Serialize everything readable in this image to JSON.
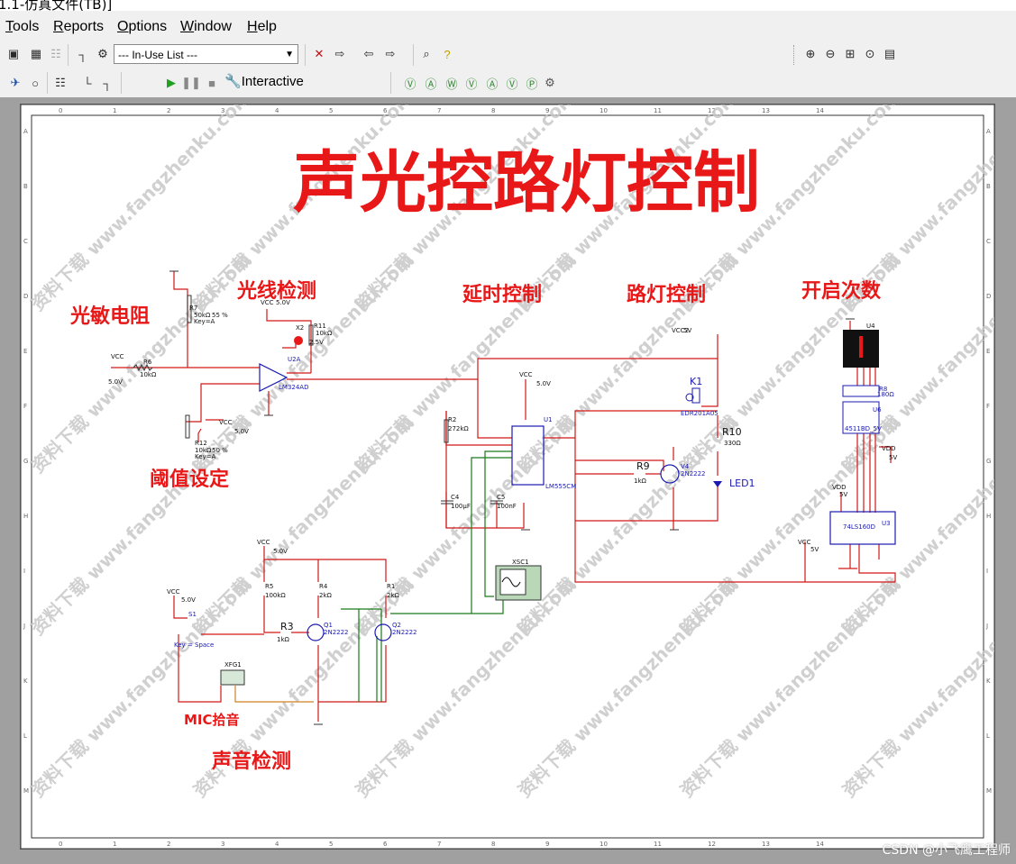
{
  "window": {
    "title": "1.1-仿真文件(TB)]"
  },
  "menu": [
    "Tools",
    "Reports",
    "Options",
    "Window",
    "Help"
  ],
  "menu_hotkeys": [
    "T",
    "R",
    "O",
    "W",
    "H"
  ],
  "toolbar": {
    "in_use_list": "--- In-Use List ---",
    "interactive_label": "Interactive"
  },
  "schematic": {
    "title": "声光控路灯控制",
    "sections": {
      "photo": "光敏电阻",
      "light_detect": "光线检测",
      "delay": "延时控制",
      "lamp": "路灯控制",
      "count": "开启次数",
      "threshold": "阈值设定",
      "mic": "MIC拾音",
      "sound": "声音检测"
    },
    "labels": {
      "r7": "R7",
      "r7v": "50kΩ",
      "r7p": "55 %",
      "r7k": "Key=A",
      "vcc_a": "VCC",
      "vcc_a_v": "5.0V",
      "x2": "X2",
      "r11": "R11",
      "r11v": "10kΩ",
      "x2v": "2.5V",
      "u2a": "U2A",
      "lm324": "LM324AD",
      "vcc_in": "VCC",
      "vcc_in_v": "5.0V",
      "r6": "R6",
      "r6v": "10kΩ",
      "vcc_t": "VCC",
      "vcc_t_v": "5.0V",
      "r12": "R12",
      "r12v": "10kΩ",
      "r12p": "50 %",
      "r12k": "Key=A",
      "vcc2": "VCC2",
      "vcc2v": "5V",
      "vcc_d": "VCC",
      "vcc_d_v": "5.0V",
      "r2": "R2",
      "r2v": "272kΩ",
      "u1": "U1",
      "lm555": "LM555CM",
      "c4": "C4",
      "c4v": "100µF",
      "c5": "C5",
      "c5v": "100nF",
      "k1": "K1",
      "edr": "EDR201A05",
      "r10": "R10",
      "r10v": "330Ω",
      "r9": "R9",
      "r9v": "1kΩ",
      "v4": "V4",
      "n2222a": "2N2222",
      "led1": "LED1",
      "u4": "U4",
      "r8": "R8",
      "r8v": "180Ω",
      "u6": "U6",
      "u6v": "4511BD_5V",
      "vdd1": "VDD",
      "vdd1v": "5V",
      "vdd2": "VDD",
      "vdd2v": "5V",
      "ls160": "74LS160D",
      "u3": "U3",
      "vcc_c": "VCC",
      "vcc_c_v": "5V",
      "vcc_s": "VCC",
      "vcc_s_v": "5.0V",
      "r5": "R5",
      "r5v": "100kΩ",
      "r4": "R4",
      "r4v": "2kΩ",
      "r1": "R1",
      "r1v": "2kΩ",
      "vcc_m": "VCC",
      "vcc_m_v": "5.0V",
      "s1": "S1",
      "keyspace": "Key = Space",
      "r3": "R3",
      "r3v": "1kΩ",
      "q1": "Q1",
      "q1t": "2N2222",
      "q2": "Q2",
      "q2t": "2N2222",
      "xfg1": "XFG1",
      "xsc1": "XSC1"
    },
    "watermark_text": "资料下载 www.fangzhenku.com",
    "ruler_top": [
      "0",
      "1",
      "2",
      "3",
      "4",
      "5",
      "6",
      "7",
      "8",
      "9",
      "10",
      "11",
      "12",
      "13",
      "14"
    ],
    "ruler_side": [
      "A",
      "B",
      "C",
      "D",
      "E",
      "F",
      "G",
      "H",
      "I",
      "J",
      "K",
      "L",
      "M"
    ],
    "colors": {
      "wire_red": "#d01818",
      "wire_green": "#1a7a1a",
      "wire_orange": "#d08020",
      "title_red": "#e81818",
      "label_blue": "#1a1ab0"
    }
  },
  "footer_watermark": "CSDN @小飞鹰工程师"
}
